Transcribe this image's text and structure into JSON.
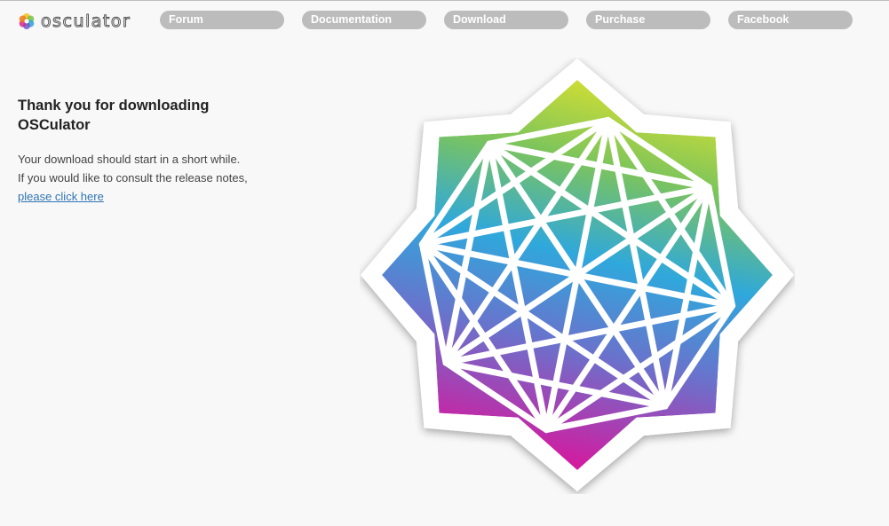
{
  "brand": {
    "name": "osculator",
    "logo_icon": "flower-logo-icon"
  },
  "nav": {
    "items": [
      {
        "label": "Forum"
      },
      {
        "label": "Documentation"
      },
      {
        "label": "Download"
      },
      {
        "label": "Purchase"
      },
      {
        "label": "Facebook"
      }
    ]
  },
  "main": {
    "headline": "Thank you for downloading OSCulator",
    "line1": "Your download should start in a short while.",
    "line2": "If you would like to consult the release notes,",
    "link_text": "please click here"
  },
  "colors": {
    "nav_pill": "#bcbcbc",
    "link": "#2f74b5",
    "background": "#f8f8f8"
  }
}
